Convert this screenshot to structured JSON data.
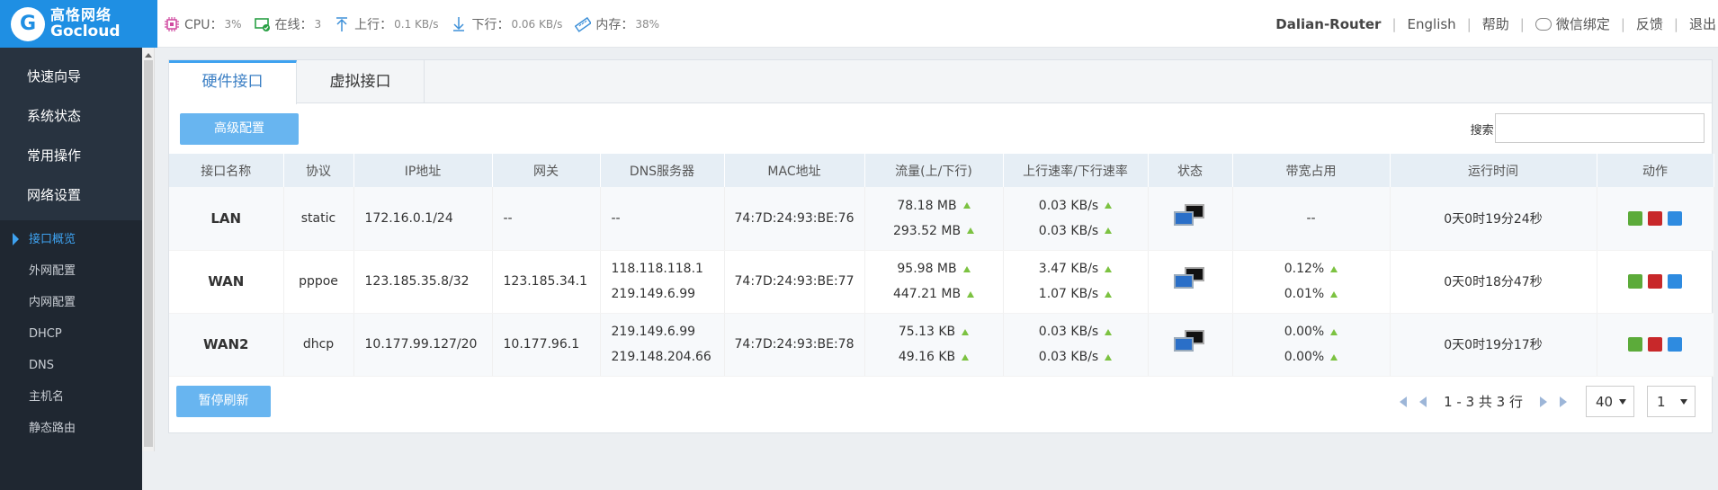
{
  "brand": {
    "name_cn": "高恪网络",
    "name_en": "Gocloud"
  },
  "stats": {
    "cpu_label": "CPU：",
    "cpu_value": "3%",
    "online_label": "在线：",
    "online_value": "3",
    "up_label": "上行：",
    "up_value": "0.1 KB/s",
    "down_label": "下行：",
    "down_value": "0.06 KB/s",
    "mem_label": "内存：",
    "mem_value": "38%"
  },
  "topnav": {
    "router": "Dalian-Router",
    "language": "English",
    "help": "帮助",
    "wechat": "微信绑定",
    "feedback": "反馈",
    "logout": "退出"
  },
  "sidebar": {
    "items": [
      "快速向导",
      "系统状态",
      "常用操作",
      "网络设置"
    ],
    "subitems": [
      "接口概览",
      "外网配置",
      "内网配置",
      "DHCP",
      "DNS",
      "主机名",
      "静态路由"
    ]
  },
  "tabs": [
    "硬件接口",
    "虚拟接口"
  ],
  "toolbar": {
    "advanced": "高级配置",
    "search_label": "搜索:"
  },
  "table": {
    "headers": [
      "接口名称",
      "协议",
      "IP地址",
      "网关",
      "DNS服务器",
      "MAC地址",
      "流量(上/下行)",
      "上行速率/下行速率",
      "状态",
      "带宽占用",
      "运行时间",
      "动作"
    ],
    "rows": [
      {
        "name": "LAN",
        "proto": "static",
        "ip": "172.16.0.1/24",
        "gw": "--",
        "dns1": "--",
        "dns2": "",
        "mac": "74:7D:24:93:BE:76",
        "traffic_up": "78.18 MB",
        "traffic_down": "293.52 MB",
        "rate_up": "0.03 KB/s",
        "rate_down": "0.03 KB/s",
        "bw1": "--",
        "bw2": "",
        "uptime": "0天0时19分24秒"
      },
      {
        "name": "WAN",
        "proto": "pppoe",
        "ip": "123.185.35.8/32",
        "gw": "123.185.34.1",
        "dns1": "118.118.118.1",
        "dns2": "219.149.6.99",
        "mac": "74:7D:24:93:BE:77",
        "traffic_up": "95.98 MB",
        "traffic_down": "447.21 MB",
        "rate_up": "3.47 KB/s",
        "rate_down": "1.07 KB/s",
        "bw1": "0.12%",
        "bw2": "0.01%",
        "uptime": "0天0时18分47秒"
      },
      {
        "name": "WAN2",
        "proto": "dhcp",
        "ip": "10.177.99.127/20",
        "gw": "10.177.96.1",
        "dns1": "219.149.6.99",
        "dns2": "219.148.204.66",
        "mac": "74:7D:24:93:BE:78",
        "traffic_up": "75.13 KB",
        "traffic_down": "49.16 KB",
        "rate_up": "0.03 KB/s",
        "rate_down": "0.03 KB/s",
        "bw1": "0.00%",
        "bw2": "0.00%",
        "uptime": "0天0时19分17秒"
      }
    ]
  },
  "footer": {
    "pause": "暂停刷新",
    "page_info": "1 - 3 共 3 行",
    "page_size": "40",
    "page_num": "1"
  }
}
